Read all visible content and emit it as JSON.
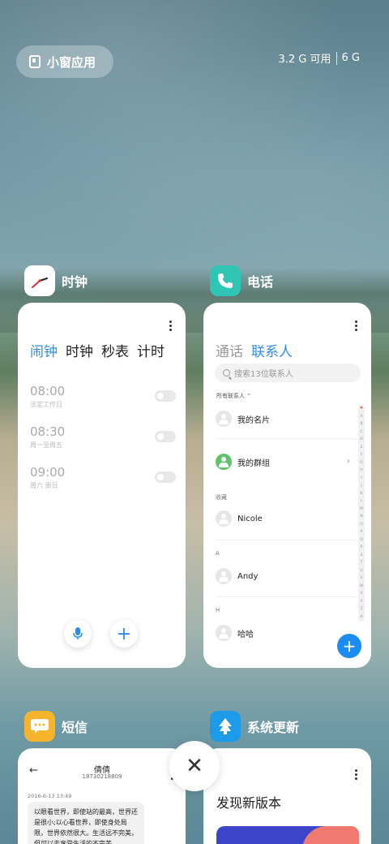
{
  "header": {
    "mini_window_label": "小窗应用",
    "memory_available": "3.2 G 可用",
    "memory_total": "6 G"
  },
  "apps": {
    "clock": {
      "name": "时钟",
      "tabs": [
        "闹钟",
        "时钟",
        "秒表",
        "计时"
      ],
      "alarms": [
        {
          "time": "08:00",
          "repeat": "法定工作日"
        },
        {
          "time": "08:30",
          "repeat": "周一至周五"
        },
        {
          "time": "09:00",
          "repeat": "周六 周日"
        }
      ]
    },
    "phone": {
      "name": "电话",
      "tabs": [
        "通话",
        "联系人"
      ],
      "search_placeholder": "搜索13位联系人",
      "all_contacts_label": "所有联系人",
      "my_card": "我的名片",
      "my_groups": "我的群组",
      "section_favorites": "收藏",
      "favorite_contact": "Nicole",
      "section_a": "A",
      "contact_a": "Andy",
      "section_h": "H",
      "contact_h": "哈哈",
      "alphabet": [
        "♥",
        "A",
        "B",
        "C",
        "D",
        "E",
        "F",
        "G",
        "H",
        "I",
        "J",
        "K",
        "L",
        "M",
        "N",
        "O",
        "P",
        "Q",
        "R",
        "S",
        "T",
        "U",
        "V",
        "W",
        "X",
        "Y",
        "Z",
        "#"
      ]
    },
    "sms": {
      "name": "短信",
      "contact_name": "倩倩",
      "contact_number": "18730218809",
      "message_date": "2016-6-13 13:49",
      "message_text": "以眼看世界，即使站的最高，世界还是很小;以心看世界，即使身处局限，世界依然很大。生活远不完美，但可以去享受生活的不完美"
    },
    "update": {
      "name": "系统更新",
      "title": "发现新版本"
    }
  },
  "colors": {
    "accent": "#2d8cf0",
    "sms_icon": "#f6b42c",
    "update_icon": "#1e9be8",
    "phone_icon": "#2fc4b4"
  }
}
